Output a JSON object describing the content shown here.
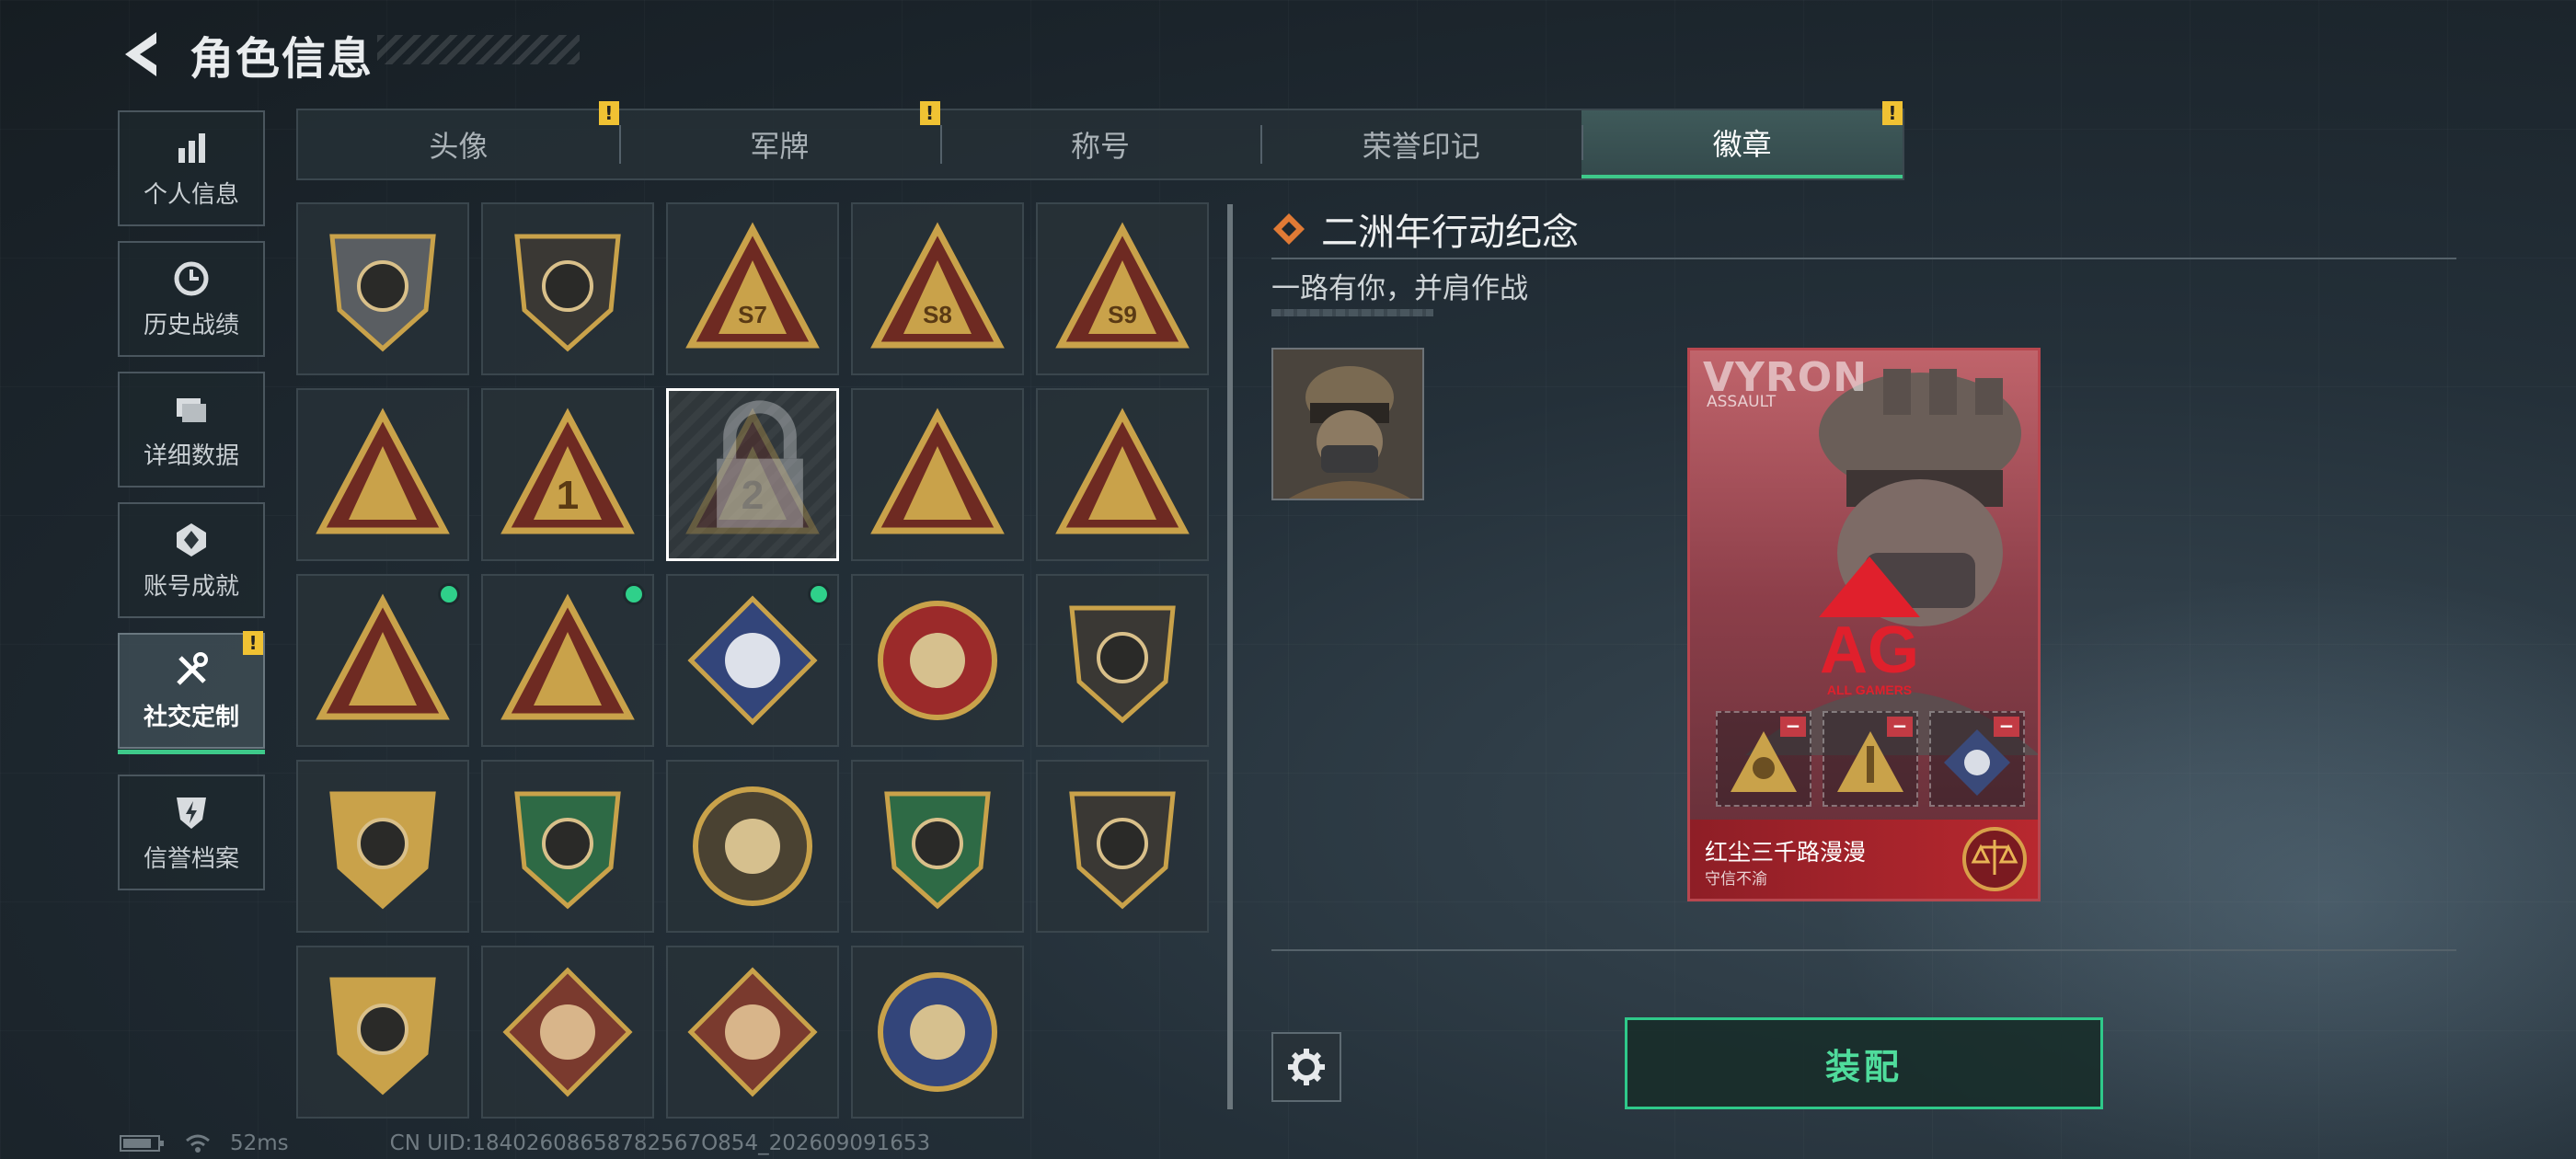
{
  "header": {
    "title": "角色信息"
  },
  "sidebar": {
    "items": [
      {
        "label": "个人信息",
        "icon": "bar-chart-icon"
      },
      {
        "label": "历史战绩",
        "icon": "clock-icon"
      },
      {
        "label": "详细数据",
        "icon": "folder-icon"
      },
      {
        "label": "账号成就",
        "icon": "medal-icon"
      },
      {
        "label": "社交定制",
        "icon": "tools-icon",
        "active": true,
        "warn": "!"
      },
      {
        "label": "信誉档案",
        "icon": "shield-bolt-icon"
      }
    ]
  },
  "tabs": [
    {
      "label": "头像",
      "warn": "!"
    },
    {
      "label": "军牌",
      "warn": "!"
    },
    {
      "label": "称号"
    },
    {
      "label": "荣誉印记"
    },
    {
      "label": "徽章",
      "active": true,
      "warn": "!"
    }
  ],
  "badges": [
    {
      "name": "grey-triangle-shield-badge",
      "state": "normal"
    },
    {
      "name": "helicopter-shield-badge",
      "state": "normal"
    },
    {
      "name": "s7-badge",
      "text": "S7",
      "state": "normal"
    },
    {
      "name": "s8-badge",
      "text": "S8",
      "state": "normal"
    },
    {
      "name": "s9-badge",
      "text": "S9",
      "state": "normal"
    },
    {
      "name": "hands-triangle-badge",
      "state": "normal"
    },
    {
      "name": "number-1-badge",
      "text": "1",
      "state": "normal"
    },
    {
      "name": "number-2-badge",
      "text": "2",
      "state": "selected-locked"
    },
    {
      "name": "figure-triangle-badge",
      "state": "normal"
    },
    {
      "name": "soldiers-triangle-badge",
      "state": "normal"
    },
    {
      "name": "soldiers-gold-badge",
      "state": "new"
    },
    {
      "name": "rocket-triangle-badge",
      "state": "new"
    },
    {
      "name": "rose-diamond-badge",
      "state": "new"
    },
    {
      "name": "star-compass-badge",
      "state": "normal"
    },
    {
      "name": "dark-shield-badge",
      "state": "normal"
    },
    {
      "name": "three-star-shield-badge",
      "state": "normal"
    },
    {
      "name": "green-gem-shield-badge",
      "state": "normal"
    },
    {
      "name": "skull-crosshair-badge",
      "state": "normal"
    },
    {
      "name": "green-rifle-shield-badge",
      "state": "normal"
    },
    {
      "name": "rifle-crest-badge",
      "state": "normal"
    },
    {
      "name": "crosshair-shield-badge",
      "state": "normal"
    },
    {
      "name": "wolf-diamond-badge",
      "state": "normal"
    },
    {
      "name": "dragon-diamond-badge",
      "state": "normal"
    },
    {
      "name": "lynx-round-badge",
      "state": "normal"
    }
  ],
  "detail": {
    "title": "二洲年行动纪念",
    "subtitle": "一路有你，并肩作战",
    "card": {
      "operator_name": "VYRON",
      "operator_role": "ASSAULT",
      "logo_text": "AG",
      "logo_sub": "ALL GAMERS",
      "motto": "红尘三千路漫漫",
      "motto_sub": "守信不渝",
      "slot_minus": "−"
    },
    "equip_label": "装配"
  },
  "status": {
    "ping": "52ms",
    "uid": "CN UID:18402608658782567O854_202609091653"
  },
  "colors": {
    "accent": "#3ec98a",
    "warn": "#f0c233",
    "card_red": "#b8282f"
  }
}
